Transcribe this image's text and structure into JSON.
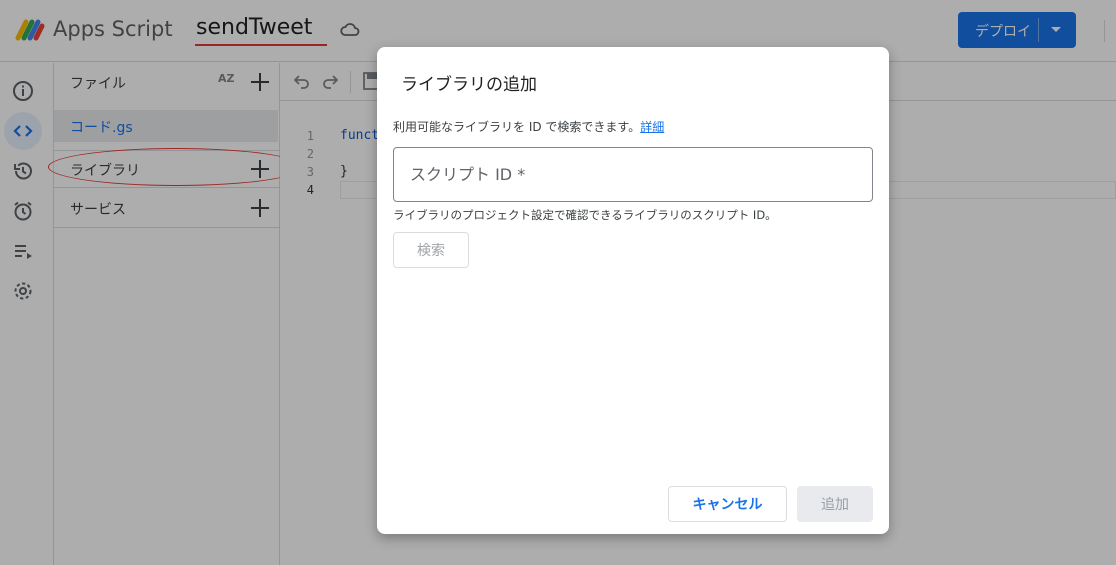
{
  "header": {
    "app_title": "Apps Script",
    "project_name": "sendTweet",
    "deploy_label": "デプロイ"
  },
  "rail": {
    "items": [
      "info-icon",
      "code-icon",
      "history-icon",
      "alarm-icon",
      "executions-icon",
      "settings-icon"
    ]
  },
  "files": {
    "title": "ファイル",
    "sort_label": "AZ",
    "file_name": "コード.gs",
    "libraries_label": "ライブラリ",
    "services_label": "サービス"
  },
  "editor": {
    "line_numbers": [
      "1",
      "2",
      "3",
      "4"
    ],
    "code_line_1": "funct",
    "code_line_3": "}"
  },
  "dialog": {
    "title": "ライブラリの追加",
    "description": "利用可能なライブラリを ID で検索できます。",
    "details_link": "詳細",
    "script_id_placeholder": "スクリプト ID *",
    "helper_text": "ライブラリのプロジェクト設定で確認できるライブラリのスクリプト ID。",
    "search_label": "検索",
    "cancel_label": "キャンセル",
    "add_label": "追加"
  },
  "colors": {
    "accent": "#1a73e8",
    "annotation": "#e53935"
  }
}
